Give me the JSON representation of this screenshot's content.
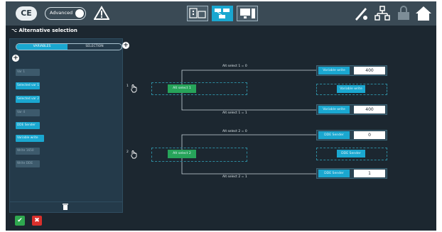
{
  "topbar": {
    "logo_text": "CE",
    "advanced_label": "Advanced",
    "advanced_on": true,
    "mode_buttons": [
      {
        "icon": "io-module-icon",
        "active": false
      },
      {
        "icon": "logic-diagram-icon",
        "active": true
      },
      {
        "icon": "computer-icon",
        "active": false
      }
    ],
    "right_icons": [
      "rocket-tool-icon",
      "network-icon",
      "settings-lock-icon",
      "home-icon"
    ]
  },
  "subbar": {
    "title": "Alternative selection"
  },
  "panel": {
    "tabs": [
      "VARIABLES",
      "SELECTION"
    ],
    "active_tab": 0,
    "variables": [
      {
        "label": "Var 1",
        "enabled": false
      },
      {
        "label": "Selected var 1",
        "enabled": true
      },
      {
        "label": "Selected var 2",
        "enabled": true
      },
      {
        "label": "Var 4",
        "enabled": false
      },
      {
        "label": "DDE Sender",
        "enabled": true
      },
      {
        "label": "Variable write",
        "enabled": true
      },
      {
        "label": "Write 1650",
        "enabled": false
      },
      {
        "label": "Write DDE",
        "enabled": false
      }
    ]
  },
  "canvas": {
    "groups": [
      {
        "number": "1",
        "selector": "Alt select 1",
        "branches": [
          {
            "label": "Alt select 1 = 0",
            "target": "Variable write",
            "value": "400"
          },
          {
            "label": "Alt select 1 = 1",
            "target": "Variable write",
            "value": "400"
          }
        ],
        "middle": "Variable write"
      },
      {
        "number": "2",
        "selector": "Alt select 2",
        "branches": [
          {
            "label": "Alt select 2 = 0",
            "target": "DDE Sender",
            "value": "0"
          },
          {
            "label": "Alt select 2 = 1",
            "target": "DDE Sender",
            "value": "1"
          }
        ],
        "middle": "DDE Sender"
      }
    ]
  },
  "footer": {
    "confirm_color": "#2fa84f",
    "cancel_color": "#d9302c"
  },
  "colors": {
    "accent": "#1aa7d0",
    "node_green": "#27a45a",
    "bg": "#1c2730"
  }
}
